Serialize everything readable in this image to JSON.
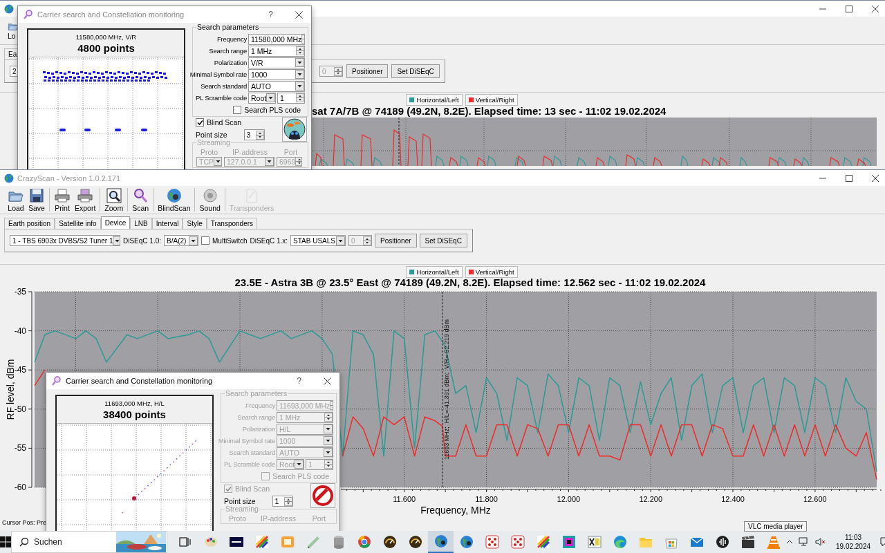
{
  "background_window": {
    "toolbar": [
      {
        "label": "Lo"
      }
    ],
    "tabs": [
      {
        "label": "Ea"
      }
    ],
    "device_row": [
      {
        "kind": "combo",
        "value": "2"
      },
      {
        "kind": "spin",
        "value": "0",
        "disabled": true
      },
      {
        "kind": "button",
        "label": "Positioner"
      },
      {
        "kind": "button",
        "label": "Set DiSEqC"
      }
    ],
    "legend": [
      {
        "label": "Horizontal/Left",
        "color": "#2a9a96"
      },
      {
        "label": "Vertical/Right",
        "color": "#ee2a2a"
      }
    ],
    "chart_title": "sat 7A/7B @ 74189 (49.2N, 8.2E). Elapsed time: 13 sec - 11:02 19.02.2024"
  },
  "top_dialog": {
    "active": false,
    "disabled": false,
    "title": "Carrier search and Constellation monitoring",
    "help": "?",
    "plot_header": "11580,000 MHz, V/R",
    "points": "4800 points",
    "params_title": "Search parameters",
    "fields": [
      {
        "label": "Frequency",
        "kind": "spin",
        "value": "11580,000 MHz"
      },
      {
        "label": "Search range",
        "kind": "spin",
        "value": "1 MHz"
      },
      {
        "label": "Polarization",
        "kind": "combo",
        "value": "V/R"
      },
      {
        "label": "Minimal Symbol rate",
        "kind": "combo",
        "value": "1000"
      },
      {
        "label": "Search standard",
        "kind": "combo",
        "value": "AUTO"
      },
      {
        "label": "PL Scramble code",
        "kind": "pair",
        "value": "Root",
        "value2": "1"
      }
    ],
    "pls": {
      "label": "Search PLS code",
      "checked": false
    },
    "blind_scan": {
      "label": "Blind Scan",
      "checked": true
    },
    "point_size": {
      "label": "Point size",
      "value": "3"
    },
    "streaming": {
      "title": "Streaming",
      "headers": [
        "Proto",
        "IP-address",
        "Port"
      ],
      "values": [
        "TCP",
        "127.0.0.1",
        "6969"
      ]
    }
  },
  "main_window": {
    "title": "CrazyScan - Version 1.0.2.171",
    "toolbar": [
      {
        "label": "Load",
        "disabled": false
      },
      {
        "label": "Save",
        "disabled": false
      },
      {
        "label": "Print",
        "disabled": false
      },
      {
        "label": "Export",
        "disabled": false
      },
      {
        "label": "Zoom",
        "disabled": false
      },
      {
        "label": "Scan",
        "disabled": false
      },
      {
        "label": "BlindScan",
        "disabled": false
      },
      {
        "label": "Sound",
        "disabled": false
      },
      {
        "label": "Transponders",
        "disabled": true
      }
    ],
    "tabs": [
      {
        "label": "Earth position",
        "selected": false
      },
      {
        "label": "Satellite info",
        "selected": false
      },
      {
        "label": "Device",
        "selected": true
      },
      {
        "label": "LNB",
        "selected": false
      },
      {
        "label": "Interval",
        "selected": false
      },
      {
        "label": "Style",
        "selected": false
      },
      {
        "label": "Transponders",
        "selected": false
      }
    ],
    "device_row": [
      {
        "kind": "combo",
        "value": "1 - TBS 6903x DVBS/S2 Tuner 1"
      },
      {
        "kind": "label",
        "text": "DiSEqC 1.0:"
      },
      {
        "kind": "combo",
        "value": "B/A(2)"
      },
      {
        "kind": "checkbox",
        "label": "MultiSwitch",
        "checked": false
      },
      {
        "kind": "label",
        "text": "DiSEqC 1.x:"
      },
      {
        "kind": "combo",
        "value": "STAB USALS"
      },
      {
        "kind": "spin",
        "value": "0",
        "disabled": true
      },
      {
        "kind": "button",
        "label": "Positioner"
      },
      {
        "kind": "button",
        "label": "Set DiSEqC"
      }
    ],
    "chart_data": {
      "type": "line",
      "title": "23.5E - Astra 3B @ 23.5° East @ 74189 (49.2N, 8.2E). Elapsed time: 12.562 sec - 11:02 19.02.2024",
      "xlabel": "Frequency, MHz",
      "ylabel": "RF level, dBm",
      "x": [
        10.7,
        10.725,
        10.75,
        10.8,
        10.825,
        10.85,
        10.875,
        10.925,
        10.95,
        11,
        11.025,
        11.075,
        11.1,
        11.125,
        11.15,
        11.2,
        11.225,
        11.25,
        11.3,
        11.325,
        11.375,
        11.4,
        11.425,
        11.45,
        11.475,
        11.5,
        11.525,
        11.55,
        11.575,
        11.6,
        11.625,
        11.65,
        11.675,
        11.693,
        11.7,
        11.725,
        11.75,
        11.775,
        11.8,
        11.825,
        11.85,
        11.875,
        11.9,
        11.925,
        11.95,
        11.975,
        12,
        12.025,
        12.05,
        12.075,
        12.1,
        12.125,
        12.15,
        12.175,
        12.2,
        12.225,
        12.25,
        12.275,
        12.3,
        12.325,
        12.35,
        12.375,
        12.4,
        12.425,
        12.45,
        12.475,
        12.5,
        12.525,
        12.55,
        12.575,
        12.6,
        12.625,
        12.65,
        12.675,
        12.7,
        12.725,
        12.75
      ],
      "series": [
        {
          "name": "Horizontal/Left",
          "color": "#2a9a96",
          "values": [
            -44,
            -40.5,
            -40,
            -41,
            -40,
            -41,
            -44,
            -40.5,
            -41,
            -40,
            -41,
            -40.5,
            -40,
            -41,
            -44,
            -40,
            -40.5,
            -41,
            -40,
            -41,
            -40,
            -41,
            -43,
            -56,
            -40,
            -40.5,
            -43,
            -56,
            -40,
            -41,
            -55,
            -40.5,
            -40,
            -41.4,
            -42,
            -48,
            -47,
            -53,
            -46,
            -48,
            -54,
            -46,
            -47,
            -53,
            -45.5,
            -47,
            -53,
            -46,
            -47,
            -54,
            -46,
            -47,
            -53,
            -46.5,
            -52,
            -48,
            -46,
            -54,
            -47,
            -45.5,
            -53,
            -47,
            -46,
            -53,
            -47,
            -46,
            -53,
            -46,
            -47,
            -53,
            -46,
            -47,
            -53,
            -46,
            -49,
            -50,
            -58
          ]
        },
        {
          "name": "Vertical/Right",
          "color": "#ee2a2a",
          "values": [
            -47,
            -45,
            null,
            null,
            null,
            null,
            null,
            null,
            null,
            null,
            null,
            null,
            null,
            null,
            null,
            null,
            null,
            null,
            null,
            null,
            null,
            null,
            null,
            -56,
            -51,
            -52.5,
            -56,
            -51,
            -52,
            -51,
            -56,
            -51,
            -51.5,
            -52.2,
            -56,
            -56,
            -52,
            -56,
            -56,
            -52,
            -52,
            -56,
            -52,
            -52.5,
            -56,
            -52,
            -52,
            -56,
            -52,
            -56,
            -56,
            -56.5,
            -52,
            -52,
            -56,
            -52,
            -56,
            -52,
            -52,
            -56,
            -52,
            -52.5,
            -56,
            -56,
            -52,
            -56,
            -52,
            -56,
            -52,
            -56,
            -52,
            -56,
            -52,
            -55,
            -56,
            -53,
            -59
          ]
        }
      ],
      "xlim": [
        10.7,
        12.75
      ],
      "ylim": [
        -60,
        -35
      ],
      "xticks": [
        {
          "value": 11.6,
          "label": "11.600"
        },
        {
          "value": 11.8,
          "label": "11.800"
        },
        {
          "value": 12,
          "label": "12.000"
        },
        {
          "value": 12.2,
          "label": "12.200"
        },
        {
          "value": 12.4,
          "label": "12.400"
        },
        {
          "value": 12.6,
          "label": "12.600"
        }
      ],
      "yticks": [
        -35,
        -40,
        -45,
        -50,
        -55,
        -60
      ],
      "grid": true,
      "legend": "top",
      "ref_lines": [
        {
          "axis": "x",
          "value": 11.693,
          "label": "11693 MHz;  H/L=-41.391 dBm;  V/R=-52.219 dBm"
        }
      ]
    },
    "status": "Cursor Pos: Pre"
  },
  "bottom_dialog": {
    "active": true,
    "disabled": true,
    "title": "Carrier search and Constellation monitoring",
    "help": "?",
    "plot_header": "11693,000 MHz, H/L",
    "points": "38400 points",
    "params_title": "Search parameters",
    "fields": [
      {
        "label": "Frequency",
        "kind": "spin",
        "value": "11693,000 MHz"
      },
      {
        "label": "Search range",
        "kind": "spin",
        "value": "1 MHz"
      },
      {
        "label": "Polarization",
        "kind": "combo",
        "value": "H/L"
      },
      {
        "label": "Minimal Symbol rate",
        "kind": "combo",
        "value": "1000"
      },
      {
        "label": "Search standard",
        "kind": "combo",
        "value": "AUTO"
      },
      {
        "label": "PL Scramble code",
        "kind": "pair",
        "value": "Root",
        "value2": "1"
      }
    ],
    "pls": {
      "label": "Search PLS code",
      "checked": false
    },
    "blind_scan": {
      "label": "Blind Scan",
      "checked": true
    },
    "point_size": {
      "label": "Point size",
      "value": "1"
    },
    "streaming": {
      "title": "Streaming",
      "headers": [
        "Proto",
        "IP-address",
        "Port"
      ]
    }
  },
  "tooltip": {
    "text": "VLC media player"
  },
  "taskbar": {
    "search": {
      "placeholder": "Suchen"
    },
    "apps": [
      {
        "selected": false
      },
      {
        "selected": false
      },
      {
        "selected": false
      },
      {
        "selected": false
      },
      {
        "selected": false
      },
      {
        "selected": false
      },
      {
        "selected": false
      },
      {
        "selected": false
      },
      {
        "selected": false
      },
      {
        "selected": false
      },
      {
        "selected": true
      },
      {
        "selected": false
      },
      {
        "selected": false
      },
      {
        "selected": false
      },
      {
        "selected": false
      },
      {
        "selected": false
      },
      {
        "selected": false
      },
      {
        "selected": false
      },
      {
        "selected": false
      },
      {
        "selected": false
      },
      {
        "selected": false
      },
      {
        "selected": false
      },
      {
        "selected": false
      },
      {
        "selected": false
      }
    ],
    "clock": {
      "time": "11:03",
      "date": "19.02.2024"
    }
  }
}
